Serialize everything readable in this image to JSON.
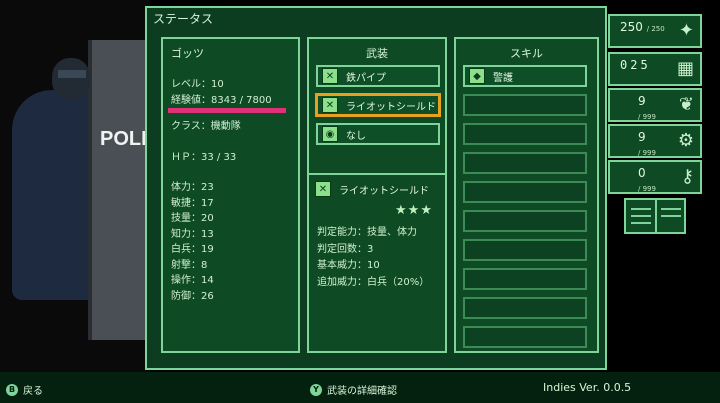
{
  "window": {
    "title": "ステータス"
  },
  "character": {
    "name": "ゴッツ",
    "level": "レベル：10",
    "exp": "経験値：8343 / 7800",
    "exp_fraction": 1.0,
    "class": "クラス：機動隊",
    "hp": "ＨＰ：33 / 33",
    "stats": [
      "体力：23",
      "敏捷：17",
      "技量：20",
      "知力：13",
      "白兵：19",
      "射撃：8",
      "操作：14",
      "防御：26"
    ],
    "art_text": "POLI"
  },
  "equipment": {
    "header": "武装",
    "slots": [
      {
        "label": "鉄パイプ",
        "icon": "crossed-weapons-icon"
      },
      {
        "label": "ライオットシールド",
        "icon": "crossed-weapons-icon",
        "selected": true
      },
      {
        "label": "なし",
        "icon": "eye-icon"
      }
    ],
    "detail": {
      "name": "ライオットシールド",
      "stars": "★★★",
      "lines": [
        "判定能力：技量、体力",
        "判定回数：3",
        "基本威力：10",
        "追加威力：白兵（20%）"
      ]
    }
  },
  "skills": {
    "header": "スキル",
    "items": [
      "警護"
    ],
    "empty_slots": 9
  },
  "resources": [
    {
      "value": "250",
      "max": "/ 250",
      "icon": "sparkle-card-icon"
    },
    {
      "value": "025",
      "max": "",
      "icon": "calendar-icon"
    },
    {
      "value": "9",
      "max": "/ 999",
      "icon": "fish-icon"
    },
    {
      "value": "9",
      "max": "/ 999",
      "icon": "gears-icon"
    },
    {
      "value": "0",
      "max": "/ 999",
      "icon": "key-icon"
    }
  ],
  "bottom": {
    "back_button": "B",
    "back_label": "戻る",
    "detail_button": "Y",
    "detail_label": "武装の詳細確認",
    "version": "Indies Ver. 0.0.5"
  },
  "colors": {
    "bg": "#0d3d20",
    "border": "#7fd49a",
    "selected": "#e8a020",
    "exp_bar": "#e0307a"
  }
}
